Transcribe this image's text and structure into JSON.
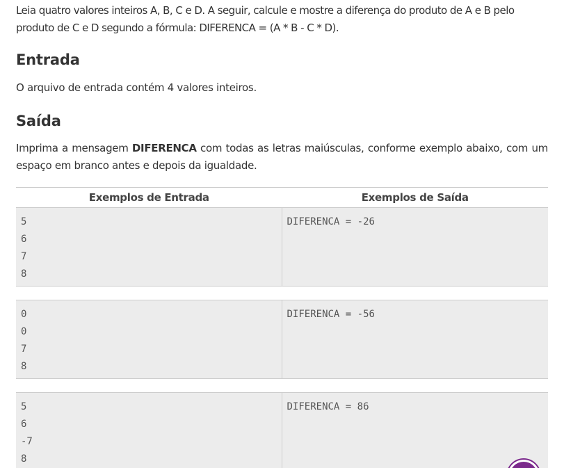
{
  "intro": "Leia quatro valores inteiros A, B, C e D. A seguir, calcule e mostre a diferença do produto de A e B pelo produto de C e D segundo a fórmula: DIFERENCA = (A * B - C * D).",
  "entrada": {
    "heading": "Entrada",
    "text": "O arquivo de entrada contém 4 valores inteiros."
  },
  "saida": {
    "heading": "Saída",
    "text_before": "Imprima a mensagem ",
    "text_bold": "DIFERENCA",
    "text_after": " com todas as letras maiúsculas, conforme exemplo abaixo, com um espaço em branco antes e depois da igualdade."
  },
  "examples": {
    "header_input": "Exemplos de Entrada",
    "header_output": "Exemplos de Saída",
    "items": [
      {
        "input": [
          "5",
          "6",
          "7",
          "8"
        ],
        "output": "DIFERENCA = -26"
      },
      {
        "input": [
          "0",
          "0",
          "7",
          "8"
        ],
        "output": "DIFERENCA = -56"
      },
      {
        "input": [
          "5",
          "6",
          "-7",
          "8"
        ],
        "output": "DIFERENCA = 86"
      }
    ]
  },
  "colors": {
    "fab": "#7b2a8c"
  }
}
